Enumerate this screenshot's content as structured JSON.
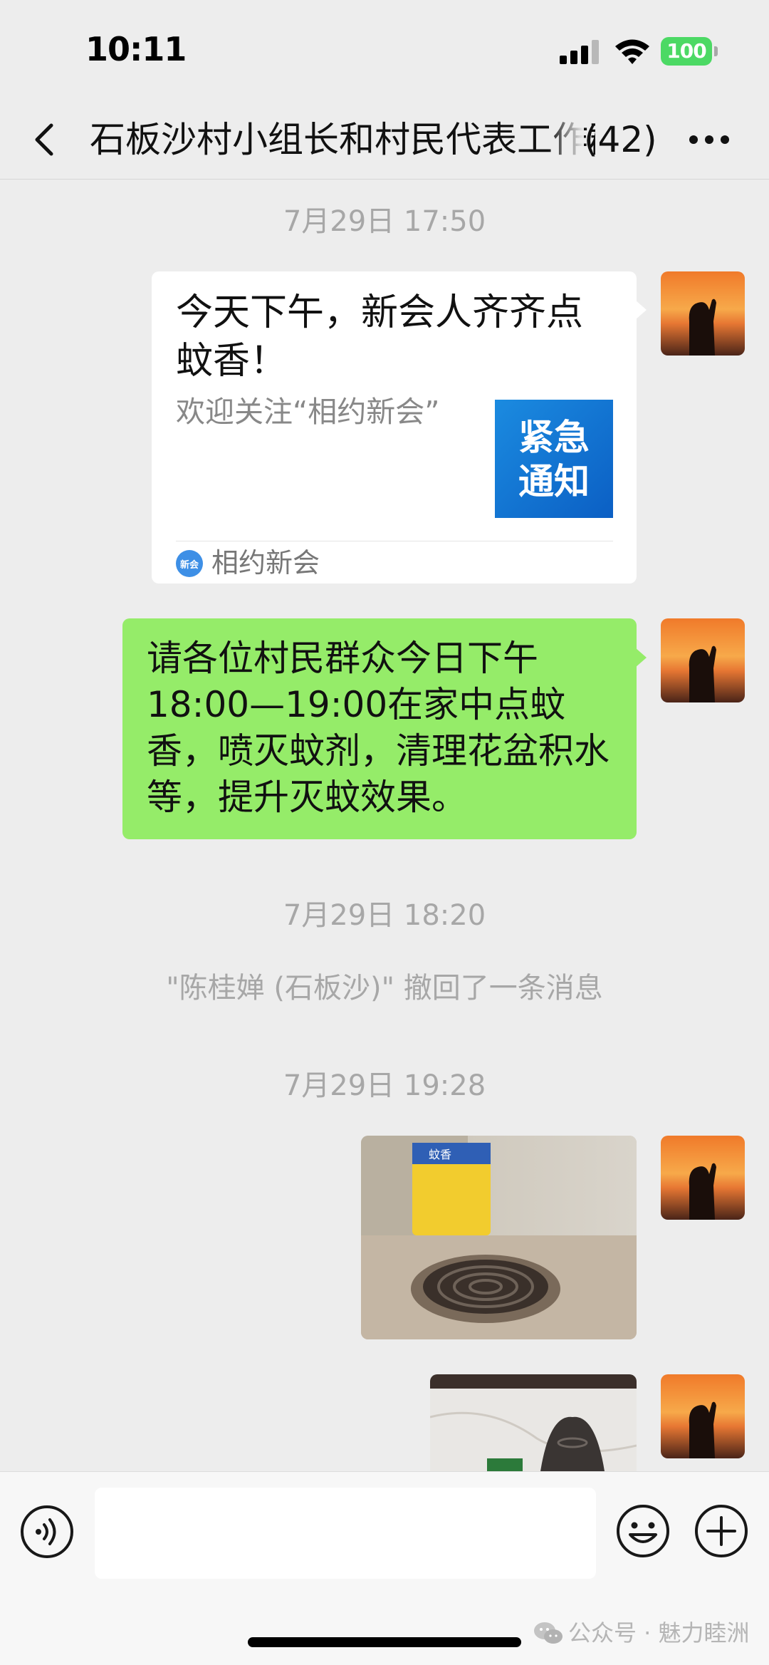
{
  "status_bar": {
    "time": "10:11",
    "battery": "100"
  },
  "header": {
    "title": "石板沙村小组长和村民代表工作群",
    "member_count": "(42)"
  },
  "messages": {
    "ts1": "7月29日 17:50",
    "card": {
      "title": "今天下午，新会人齐齐点蚊香！",
      "description": "欢迎关注“相约新会”",
      "thumb_text_1": "紧急",
      "thumb_text_2": "通知",
      "source_logo_text": "新会",
      "source": "相约新会"
    },
    "text_message": "请各位村民群众今日下午18:00—19:00在家中点蚊香，喷灭蚊剂，清理花盆积水等，提升灭蚊效果。",
    "ts2": "7月29日 18:20",
    "recall_notice": "\"陈桂婵 (石板沙)\" 撤回了一条消息",
    "ts3": "7月29日 19:28",
    "photo_label": "蚊香"
  },
  "input": {
    "placeholder": ""
  },
  "watermark": "公众号 · 魅力睦洲",
  "colors": {
    "background": "#ededed",
    "sent_bubble": "#95ec69",
    "battery": "#4cd964"
  }
}
